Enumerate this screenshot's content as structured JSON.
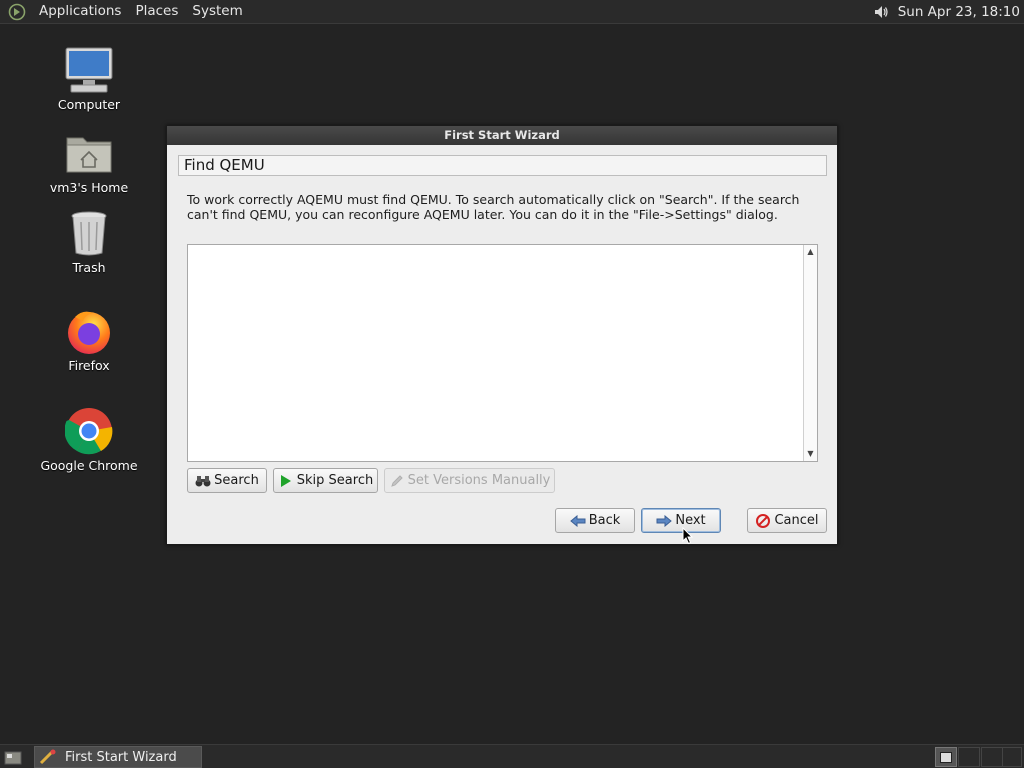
{
  "top_panel": {
    "menus": [
      "Applications",
      "Places",
      "System"
    ],
    "clock": "Sun Apr 23, 18:10"
  },
  "desktop_icons": [
    {
      "label": "Computer",
      "icon": "computer-icon"
    },
    {
      "label": "vm3's Home",
      "icon": "home-folder-icon"
    },
    {
      "label": "Trash",
      "icon": "trash-icon"
    },
    {
      "label": "Firefox",
      "icon": "firefox-icon"
    },
    {
      "label": "Google Chrome",
      "icon": "chrome-icon"
    }
  ],
  "dialog": {
    "title": "First Start Wizard",
    "page_header": "Find QEMU",
    "description": "To work correctly AQEMU must find QEMU. To search automatically click on \"Search\". If the search can't find QEMU, you can reconfigure AQEMU later. You can do it in the \"File->Settings\" dialog.",
    "output_text": "",
    "buttons": {
      "search": "Search",
      "skip_search": "Skip Search",
      "set_versions": "Set Versions Manually",
      "back": "Back",
      "next": "Next",
      "cancel": "Cancel"
    }
  },
  "taskbar": {
    "tasks": [
      {
        "label": "First Start Wizard",
        "icon": "aqemu-icon"
      }
    ]
  },
  "colors": {
    "desktop_bg": "#232323",
    "panel_bg": "#2a2a2a",
    "dialog_bg": "#ededed",
    "titlebar": "#3f3f3f"
  }
}
